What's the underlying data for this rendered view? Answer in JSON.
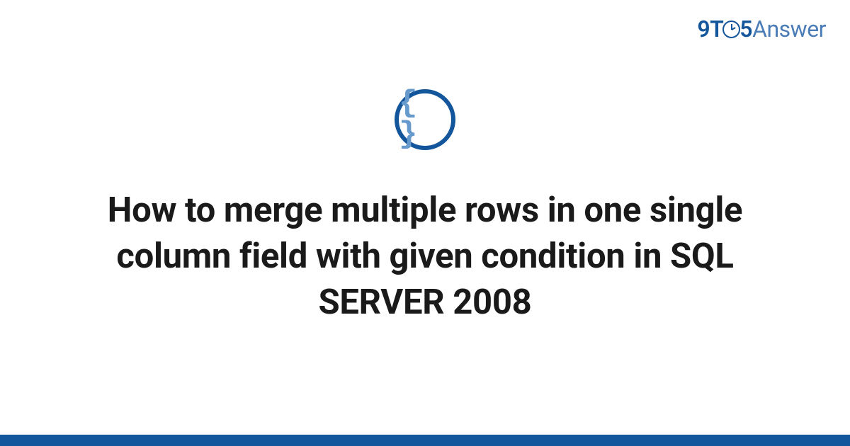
{
  "logo": {
    "prefix_9": "9",
    "letter_t": "T",
    "digit_5": "5",
    "suffix": "Answer"
  },
  "icon": {
    "name": "braces-icon",
    "glyph": "{ }"
  },
  "title": "How to merge multiple rows in one single column field with given condition in SQL SERVER 2008",
  "colors": {
    "primary": "#14569c",
    "icon_inner": "#6699cc"
  }
}
